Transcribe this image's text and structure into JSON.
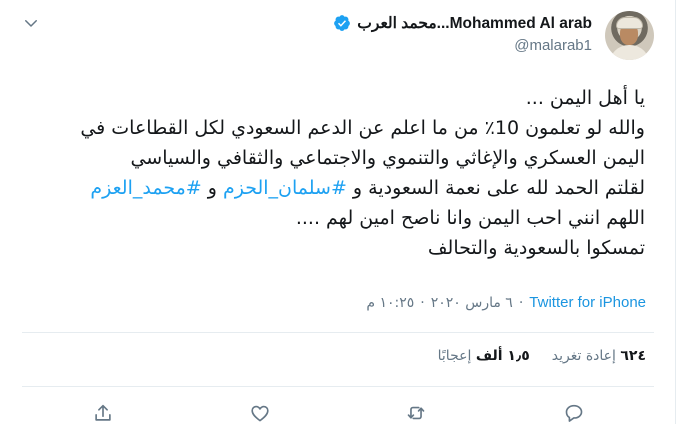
{
  "author": {
    "display_name": "محمد العرب...Mohammed Al arab",
    "handle": "@malarab1",
    "verified": true
  },
  "tweet": {
    "lines": [
      {
        "parts": [
          {
            "text": "يا أهل اليمن ...",
            "type": "text"
          }
        ]
      },
      {
        "parts": [
          {
            "text": "والله لو تعلمون 10٪ من ما اعلم عن الدعم السعودي لكل القطاعات في",
            "type": "text"
          }
        ]
      },
      {
        "parts": [
          {
            "text": "اليمن العسكري والإغاثي والتنموي والاجتماعي والثقافي والسياسي",
            "type": "text"
          }
        ]
      },
      {
        "parts": [
          {
            "text": "لقلتم الحمد لله على نعمة السعودية و ",
            "type": "text"
          },
          {
            "text": "#سلمان_الحزم",
            "type": "hashtag"
          },
          {
            "text": " و ",
            "type": "text"
          },
          {
            "text": "#محمد_العزم",
            "type": "hashtag"
          }
        ]
      },
      {
        "parts": [
          {
            "text": "اللهم انني احب اليمن وانا ناصح امين لهم ....",
            "type": "text"
          }
        ]
      },
      {
        "parts": [
          {
            "text": "تمسكوا بالسعودية والتحالف",
            "type": "text"
          }
        ]
      }
    ]
  },
  "meta": {
    "time": "١٠:٢٥ م",
    "separator": "·",
    "date": "٦ مارس ٢٠٢٠",
    "source": "Twitter for iPhone"
  },
  "stats": {
    "retweets_count": "٦٢٤",
    "retweets_label": "إعادة تغريد",
    "likes_count": "١٫٥ ألف",
    "likes_label": "إعجابًا"
  },
  "icons": {
    "verified": "verified-badge-icon",
    "caret": "chevron-down-icon",
    "reply": "reply-icon",
    "retweet": "retweet-icon",
    "like": "heart-icon",
    "share": "share-icon"
  },
  "colors": {
    "accent": "#1da1f2",
    "link": "#1b95e0",
    "muted": "#657786",
    "text": "#14171a",
    "border": "#e6ecf0"
  }
}
